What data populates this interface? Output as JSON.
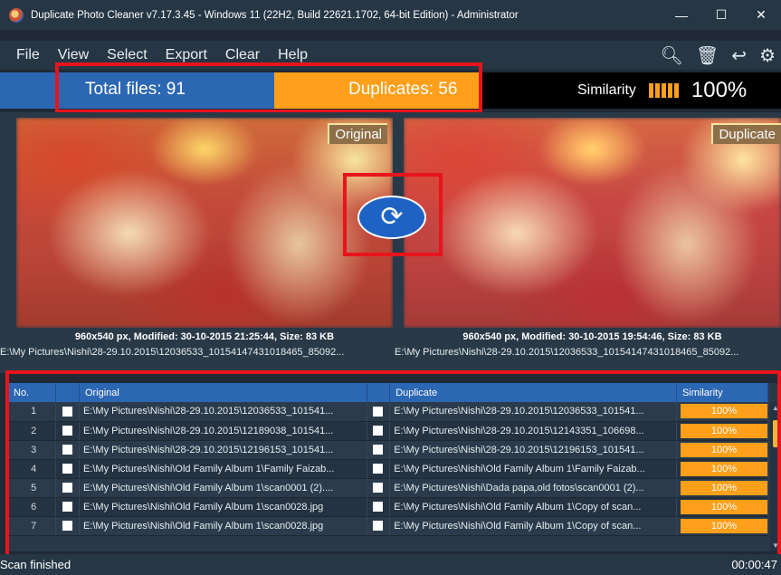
{
  "window": {
    "title": "Duplicate Photo Cleaner v7.17.3.45 - Windows 11 (22H2, Build 22621.1702, 64-bit Edition) - Administrator",
    "minimize": "—",
    "maximize": "☐",
    "close": "✕"
  },
  "menu": [
    "File",
    "View",
    "Select",
    "Export",
    "Clear",
    "Help"
  ],
  "toolbar_icons": [
    "search-icon",
    "trash-icon",
    "undo-icon",
    "settings-icon"
  ],
  "stats": {
    "total_label": "Total files: 91",
    "duplicates_label": "Duplicates: 56",
    "similarity_label": "Similarity",
    "similarity_value": "100%",
    "similarity_level": 1.0
  },
  "preview": {
    "original_tag": "Original",
    "duplicate_tag": "Duplicate",
    "original_meta": "960x540 px, Modified: 30-10-2015 21:25:44, Size: 83 KB",
    "duplicate_meta": "960x540 px, Modified: 30-10-2015 19:54:46, Size: 83 KB",
    "original_path": "E:\\My Pictures\\Nishi\\28-29.10.2015\\12036533_10154147431018465_85092...",
    "duplicate_path": "E:\\My Pictures\\Nishi\\28-29.10.2015\\12036533_10154147431018465_85092..."
  },
  "table": {
    "headers": {
      "no": "No.",
      "original": "Original",
      "duplicate": "Duplicate",
      "similarity": "Similarity"
    },
    "rows": [
      {
        "no": "1",
        "original": "E:\\My Pictures\\Nishi\\28-29.10.2015\\12036533_101541...",
        "duplicate": "E:\\My Pictures\\Nishi\\28-29.10.2015\\12036533_101541...",
        "similarity": "100%"
      },
      {
        "no": "2",
        "original": "E:\\My Pictures\\Nishi\\28-29.10.2015\\12189038_101541...",
        "duplicate": "E:\\My Pictures\\Nishi\\28-29.10.2015\\12143351_106698...",
        "similarity": "100%"
      },
      {
        "no": "3",
        "original": "E:\\My Pictures\\Nishi\\28-29.10.2015\\12196153_101541...",
        "duplicate": "E:\\My Pictures\\Nishi\\28-29.10.2015\\12196153_101541...",
        "similarity": "100%"
      },
      {
        "no": "4",
        "original": "E:\\My Pictures\\Nishi\\Old Family Album 1\\Family Faizab...",
        "duplicate": "E:\\My Pictures\\Nishi\\Old Family Album 1\\Family Faizab...",
        "similarity": "100%"
      },
      {
        "no": "5",
        "original": "E:\\My Pictures\\Nishi\\Old Family Album 1\\scan0001 (2)....",
        "duplicate": "E:\\My Pictures\\Nishi\\Dada papa,old fotos\\scan0001 (2)...",
        "similarity": "100%"
      },
      {
        "no": "6",
        "original": "E:\\My Pictures\\Nishi\\Old Family Album 1\\scan0028.jpg",
        "duplicate": "E:\\My Pictures\\Nishi\\Old Family Album 1\\Copy of scan...",
        "similarity": "100%"
      },
      {
        "no": "7",
        "original": "E:\\My Pictures\\Nishi\\Old Family Album 1\\scan0028.jpg",
        "duplicate": "E:\\My Pictures\\Nishi\\Old Family Album 1\\Copy of scan...",
        "similarity": "100%"
      }
    ]
  },
  "status": {
    "message": "Scan finished",
    "elapsed": "00:00:47"
  }
}
